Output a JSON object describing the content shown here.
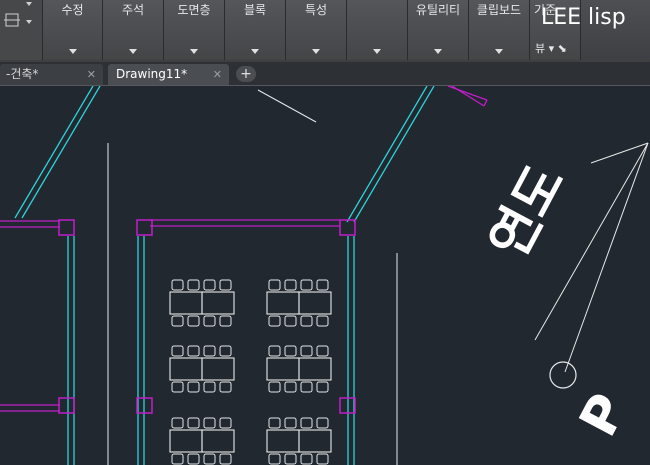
{
  "ribbon": {
    "panels": [
      {
        "label": "수정"
      },
      {
        "label": "주석"
      },
      {
        "label": "도면층"
      },
      {
        "label": "블록"
      },
      {
        "label": "특성"
      },
      {
        "label": ""
      },
      {
        "label": "유틸리티"
      },
      {
        "label": "클립보드"
      },
      {
        "label": "기준"
      }
    ],
    "view_label": "뷰 ▾ ⬊",
    "overlay_title": "LEE lisp"
  },
  "tabs": [
    {
      "label": "-건축*",
      "active": false
    },
    {
      "label": "Drawing11*",
      "active": true
    }
  ],
  "drawing": {
    "large_text_1": "연도",
    "large_text_2": "P"
  },
  "colors": {
    "cyan_wall": "#2fd3d8",
    "magenta_column": "#c01ec8",
    "line_white": "#e8e8e8",
    "background": "#212830"
  }
}
